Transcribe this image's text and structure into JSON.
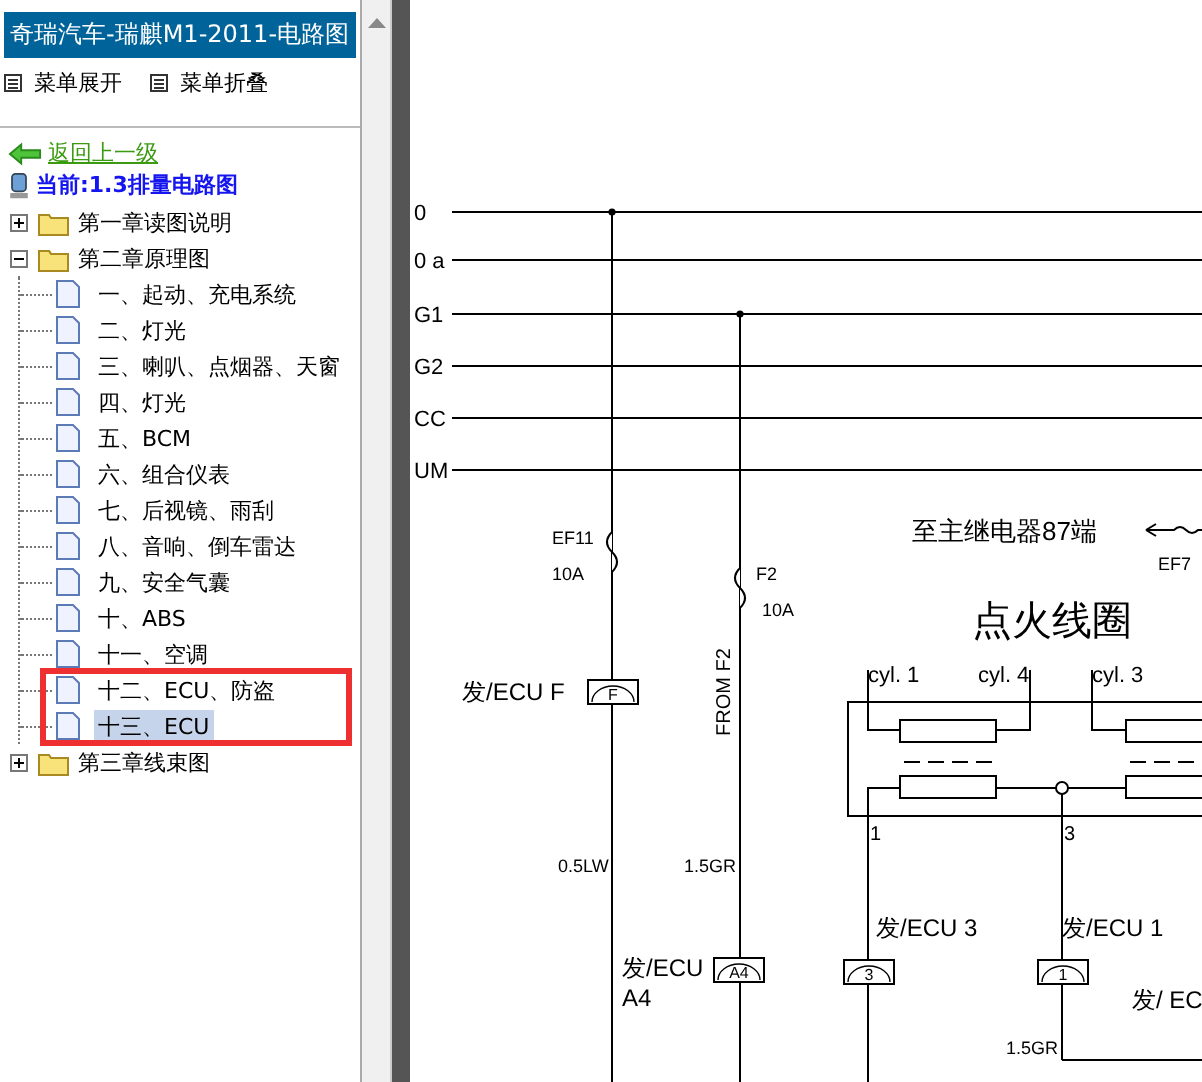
{
  "sidebar": {
    "title": "奇瑞汽车-瑞麒M1-2011-电路图",
    "menu_actions": [
      "菜单展开",
      "菜单折叠"
    ],
    "back_link": "返回上一级",
    "current": "当前:1.3排量电路图",
    "tree": [
      {
        "label": "第一章读图说明",
        "expanded": false
      },
      {
        "label": "第二章原理图",
        "expanded": true,
        "children": [
          {
            "label": "一、起动、充电系统",
            "selected": false
          },
          {
            "label": "二、灯光",
            "selected": false
          },
          {
            "label": "三、喇叭、点烟器、天窗",
            "selected": false
          },
          {
            "label": "四、灯光",
            "selected": false
          },
          {
            "label": "五、BCM",
            "selected": false
          },
          {
            "label": "六、组合仪表",
            "selected": false
          },
          {
            "label": "七、后视镜、雨刮",
            "selected": false
          },
          {
            "label": "八、音响、倒车雷达",
            "selected": false
          },
          {
            "label": "九、安全气囊",
            "selected": false
          },
          {
            "label": "十、ABS",
            "selected": false
          },
          {
            "label": "十一、空调",
            "selected": false
          },
          {
            "label": "十二、ECU、防盗",
            "selected": false
          },
          {
            "label": "十三、ECU",
            "selected": true
          }
        ]
      },
      {
        "label": "第三章线束图",
        "expanded": false
      }
    ]
  },
  "diagram": {
    "bus_labels": [
      "0",
      "0 a",
      "G1",
      "G2",
      "CC",
      "UM"
    ],
    "fuses": [
      {
        "name": "EF11",
        "rating": "10A"
      },
      {
        "name": "F2",
        "rating": "10A"
      }
    ],
    "feed_label": "FROM F2",
    "connectors": [
      {
        "label": "发/ECU F",
        "pin": "F"
      },
      {
        "label": "发/ECU",
        "sublabel": "A4",
        "pin": "A4"
      },
      {
        "label": "发/ECU 3",
        "pin": "3"
      },
      {
        "label": "发/ECU 1",
        "pin": "1"
      }
    ],
    "wire_labels": [
      "0.5LW",
      "1.5GR",
      "1.5GR"
    ],
    "relay_note": "至主继电器87端",
    "relay_fuse": "EF7",
    "coil_title": "点火线圈",
    "cylinders": [
      "cyl. 1",
      "cyl. 4",
      "cyl. 3"
    ],
    "terminals": [
      "1",
      "3"
    ],
    "partial_label": "发/ EC"
  }
}
